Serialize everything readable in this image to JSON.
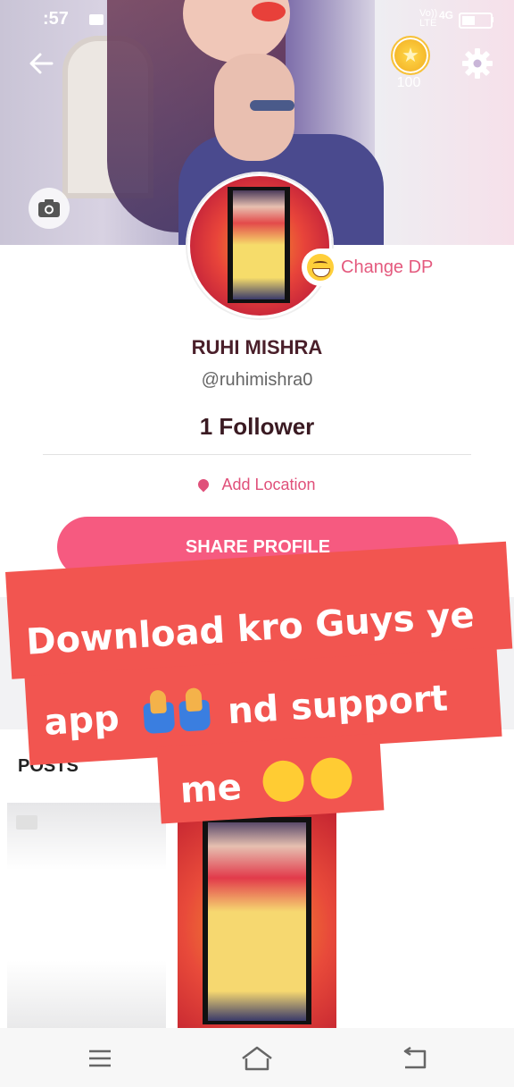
{
  "status": {
    "time": ":57",
    "signal": "Vo))\nLTE",
    "network": "4G"
  },
  "header": {
    "coins": "100"
  },
  "profile": {
    "change_dp_label": "Change DP",
    "name": "RUHI MISHRA",
    "handle": "@ruhimishra0",
    "followers": "1 Follower",
    "location_label": "Add Location",
    "share_label": "SHARE PROFILE"
  },
  "posts": {
    "title": "POSTS"
  },
  "overlay": {
    "line1": "Download kro Guys ye",
    "line2": "app",
    "line2b": "nd support",
    "line3": "me"
  },
  "colors": {
    "accent": "#f65a80",
    "link": "#e0507a",
    "sticker": "#f25550"
  },
  "icons": [
    "back-arrow-icon",
    "coin-icon",
    "gear-icon",
    "camera-icon",
    "location-pin-icon",
    "video-icon",
    "menu-icon",
    "home-icon",
    "back-nav-icon"
  ]
}
